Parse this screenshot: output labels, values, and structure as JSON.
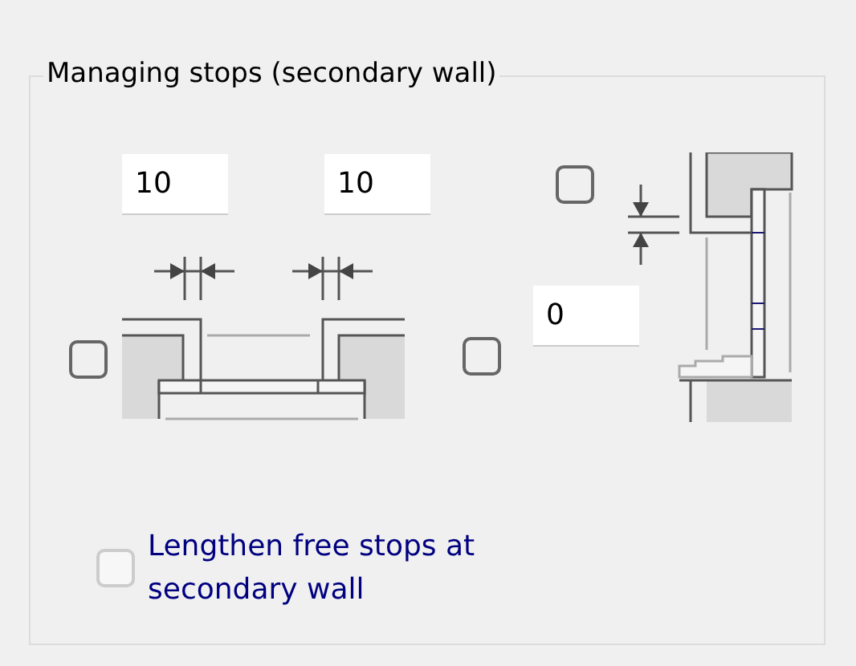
{
  "title": "Managing stops (secondary wall)",
  "left_stop": {
    "value": "10"
  },
  "right_stop": {
    "value": "10"
  },
  "left_wall": {
    "checked": false
  },
  "right_wall": {
    "checked": false
  },
  "top_stop": {
    "checked": false
  },
  "offset": {
    "value": "0"
  },
  "lengthen": {
    "label": "Lengthen free stops at secondary wall",
    "checked": false,
    "disabled": true
  }
}
